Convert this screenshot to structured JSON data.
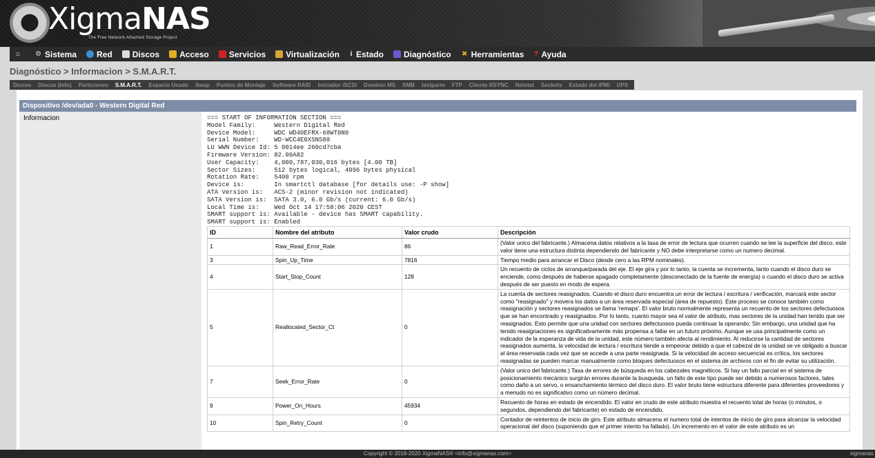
{
  "header": {
    "logo_text_a": "Xigma",
    "logo_text_b": "NAS",
    "tagline": "The Free Network-Attached Storage Project"
  },
  "nav": {
    "items": [
      {
        "label": "Sistema",
        "icon": "gear-icon"
      },
      {
        "label": "Red",
        "icon": "globe-icon"
      },
      {
        "label": "Discos",
        "icon": "disk-icon"
      },
      {
        "label": "Acceso",
        "icon": "lock-icon"
      },
      {
        "label": "Servicios",
        "icon": "car-icon"
      },
      {
        "label": "Virtualización",
        "icon": "vm-icon"
      },
      {
        "label": "Estado",
        "icon": "info-icon"
      },
      {
        "label": "Diagnóstico",
        "icon": "diagnostic-icon"
      },
      {
        "label": "Herramientas",
        "icon": "tools-icon"
      },
      {
        "label": "Ayuda",
        "icon": "help-icon"
      }
    ]
  },
  "breadcrumb": "Diagnóstico > Informacion > S.M.A.R.T.",
  "subtabs": [
    "Discos",
    "Discos (Info)",
    "Particiones",
    "S.M.A.R.T.",
    "Espacio Usado",
    "Swap",
    "Puntos de Montaje",
    "Software RAID",
    "Iniciador iSCSI",
    "Dominio MS",
    "SMB",
    "testparm",
    "FTP",
    "Cliente RSYNC",
    "Netstat",
    "Sockets",
    "Estado del IPMI",
    "UPS"
  ],
  "active_subtab": "S.M.A.R.T.",
  "section_title": "Dispositivo /dev/ada0 - Western Digital Red",
  "left_label": "Informacion",
  "info_lines": [
    "=== START OF INFORMATION SECTION ===",
    "Model Family:     Western Digital Red",
    "Device Model:     WDC WD40EFRX-68WT0N0",
    "Serial Number:    WD-WCC4E0XSNS88",
    "LU WWN Device Id: 5 0014ee 260cd7cba",
    "Firmware Version: 82.00A82",
    "User Capacity:    4,000,787,030,016 bytes [4.00 TB]",
    "Sector Sizes:     512 bytes logical, 4096 bytes physical",
    "Rotation Rate:    5400 rpm",
    "Device is:        In smartctl database [for details use: -P show]",
    "ATA Version is:   ACS-2 (minor revision not indicated)",
    "SATA Version is:  SATA 3.0, 6.0 Gb/s (current: 6.0 Gb/s)",
    "Local Time is:    Wed Oct 14 17:58:06 2020 CEST",
    "SMART support is: Available - device has SMART capability.",
    "SMART support is: Enabled"
  ],
  "table": {
    "headers": [
      "ID",
      "Nombre del atributo",
      "Valor crudo",
      "Descripción"
    ],
    "rows": [
      {
        "id": "1",
        "name": "Raw_Read_Error_Rate",
        "value": "86",
        "desc": "(Valor unico del fabricante.) Almacena datos relativos a la tasa de error de lectura que ocurren cuando se lee la superficie del disco. este valor tiene una estructura distinta dependiendo del fabricante y NO debe interpretarse como un numero decimal."
      },
      {
        "id": "3",
        "name": "Spin_Up_Time",
        "value": "7816",
        "desc": "Tiempo medio para arrancar el Disco (desde cero a las RPM nominales)."
      },
      {
        "id": "4",
        "name": "Start_Stop_Count",
        "value": "128",
        "desc": "Un recuento de ciclos de arranque/parada del eje. El eje gira y por lo tanto, la cuenta se incrementa, tanto cuando el disco duro se enciende, como después de haberse apagado completamente (desconectado de la fuente de energía) o cuando el disco duro se activa después de ser puesto en modo de espera."
      },
      {
        "id": "5",
        "name": "Reallocated_Sector_Ct",
        "value": "0",
        "desc": "La cuenta de sectores reasignados. Cuando el disco duro encuentra un error de lectura / escritura / verificación, marcará este sector como \"reasignado\" y movera los datos a un área reservada especial (área de repuesto). Este proceso se conoce también como reasignación y sectores reasignados se llama 'remaps'. El valor bruto normalmente representa un recuento de los sectores defectuosos que se han encontrado y reasignados. Por lo tanto, cuanto mayor sea el valor de atributo, mas sectores de la unidad han tenido que ser reasignados. Esto permite que una unidad con sectores defectuosos pueda continuar la operando; Sin embargo, una unidad que ha tenido reasignaciones es significativamente más propensa a fallar en un futuro próximo. Aunque se usa principalmente como un indicador de la esperanza de vida de la unidad, este número también afecta al rendimiento. Al reducirse la cantidad de sectores reasignados aumenta, la velocidad de lectura / escritura tiende a empeorar debido a que el cabezal de la unidad se ve obligado a buscar al área reservada cada vez que se accede a una parte reasignada. Si la velocidad de acceso secuencial es crítica, los sectores reasignadas se pueden marcar manualmente como bloques defectuosos en el sistema de archivos con el fin de evitar su utilización."
      },
      {
        "id": "7",
        "name": "Seek_Error_Rate",
        "value": "0",
        "desc": "(Valor unico del fabricante.) Tasa de errores de búsqueda en los cabezales magnéticos. Si hay un fallo parcial en el sistema de posicionamiento mecánico surgirán errores durante la busqueda. un fallo de este tipo puede ser debido a numerosos factores, tales como daño a un servo, o ensanchamiento térmico del disco duro. El valor bruto tiene estructura diferente para diferentes proveedores y a menudo no es significativo como un número decimal."
      },
      {
        "id": "9",
        "name": "Power_On_Hours",
        "value": "45934",
        "desc": "Recuento de horas en estado de encendido. El valor en crudo de este atributo muestra el recuento total de horas (o minutos, o segundos, dependiendo del fabricante) en estado de encendido."
      },
      {
        "id": "10",
        "name": "Spin_Retry_Count",
        "value": "0",
        "desc": "Contador de reintentos de inicio de giro. Este atributo almacena el numero total de intentos de inicio de giro para alcanzar la velocidad operacional del disco (suponiendo que el primer intento ha fallado). Un incremento en el valor de este atributo es un"
      }
    ]
  },
  "footer": "Copyright © 2018-2020 XigmaNAS® <info@xigmanas.com>",
  "footer_user": "xigmanas"
}
